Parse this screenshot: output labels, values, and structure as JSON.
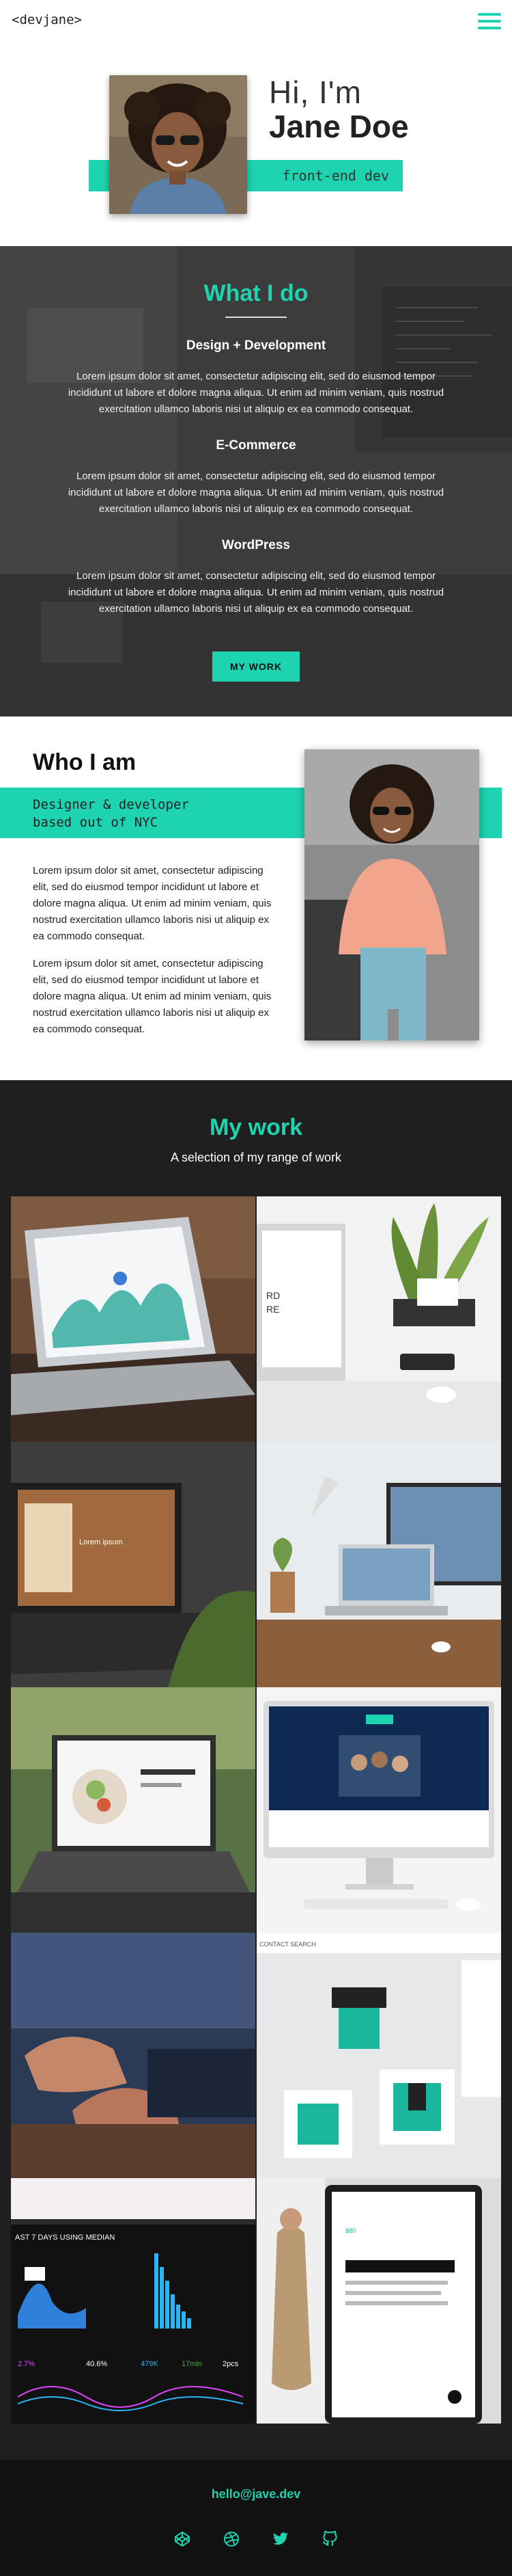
{
  "header": {
    "logo": "<devjane>",
    "menu_icon": "hamburger-icon"
  },
  "intro": {
    "greeting": "Hi, I'm",
    "name": "Jane Doe",
    "role": "front-end dev"
  },
  "what_i_do": {
    "title": "What I do",
    "services": [
      {
        "title": "Design + Development",
        "text": "Lorem ipsum dolor sit amet, consectetur adipiscing elit, sed do eiusmod tempor incididunt ut labore et dolore magna aliqua. Ut enim ad minim veniam, quis nostrud exercitation ullamco laboris nisi ut aliquip ex ea commodo consequat."
      },
      {
        "title": "E-Commerce",
        "text": "Lorem ipsum dolor sit amet, consectetur adipiscing elit, sed do eiusmod tempor incididunt ut labore et dolore magna aliqua. Ut enim ad minim veniam, quis nostrud exercitation ullamco laboris nisi ut aliquip ex ea commodo consequat."
      },
      {
        "title": "WordPress",
        "text": "Lorem ipsum dolor sit amet, consectetur adipiscing elit, sed do eiusmod tempor incididunt ut labore et dolore magna aliqua. Ut enim ad minim veniam, quis nostrud exercitation ullamco laboris nisi ut aliquip ex ea commodo consequat."
      }
    ],
    "button": "MY WORK"
  },
  "who_i_am": {
    "title": "Who I am",
    "tagline": "Designer & developer\nbased out of NYC",
    "paragraphs": [
      "Lorem ipsum dolor sit amet, consectetur adipiscing elit, sed do eiusmod tempor incididunt ut labore et dolore magna aliqua. Ut enim ad minim veniam, quis nostrud exercitation ullamco laboris nisi ut aliquip ex ea commodo consequat.",
      "Lorem ipsum dolor sit amet, consectetur adipiscing elit, sed do eiusmod tempor incididunt ut labore et dolore magna aliqua. Ut enim ad minim veniam, quis nostrud exercitation ullamco laboris nisi ut aliquip ex ea commodo consequat."
    ]
  },
  "my_work": {
    "title": "My work",
    "subtitle": "A selection of my range of work"
  },
  "footer": {
    "email": "hello@jave.dev",
    "socials": [
      "codepen-icon",
      "dribbble-icon",
      "twitter-icon",
      "github-icon"
    ]
  },
  "colors": {
    "accent": "#1dd3b0",
    "dark": "#1f1f1f",
    "footer": "#111111"
  }
}
